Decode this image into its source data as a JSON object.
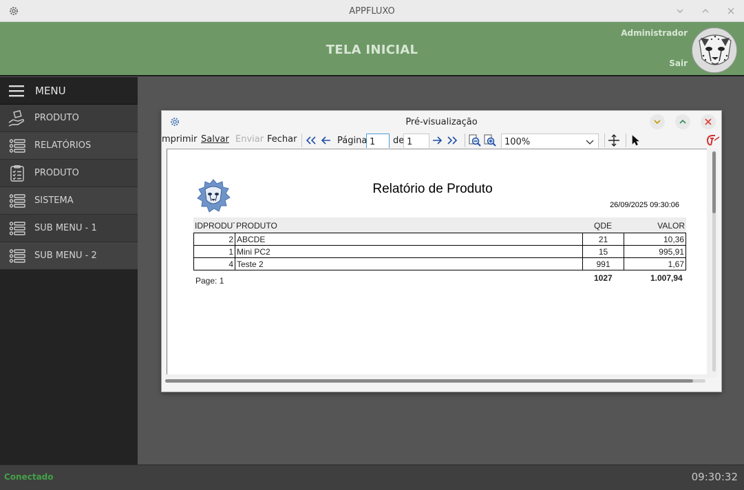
{
  "window": {
    "title": "APPFLUXO"
  },
  "header": {
    "screen_title": "TELA INICIAL",
    "user": "Administrador",
    "logout": "Sair"
  },
  "sidebar": {
    "title": "MENU",
    "items": [
      {
        "label": "PRODUTO",
        "icon": "hand-box-icon"
      },
      {
        "label": "RELATÓRIOS",
        "icon": "list-icon"
      },
      {
        "label": "PRODUTO",
        "icon": "checklist-icon"
      },
      {
        "label": "SISTEMA",
        "icon": "list-icon"
      },
      {
        "label": "SUB MENU - 1",
        "icon": "list-icon"
      },
      {
        "label": "SUB MENU - 2",
        "icon": "list-icon"
      }
    ]
  },
  "status": {
    "connection": "Conectado",
    "time": "09:30:32",
    "connection_color": "#43a047"
  },
  "preview": {
    "title": "Pré-visualização",
    "toolbar": {
      "print": "mprimir",
      "save": "Salvar",
      "send": "Enviar",
      "close": "Fechar",
      "page_label": "Página",
      "page_value": "1",
      "of_label": "de",
      "of_value": "1",
      "zoom": "100%"
    },
    "report": {
      "title": "Relatório de Produto",
      "datetime": "26/09/2025 09:30:06",
      "columns": [
        "IDPRODUTO",
        "PRODUTO",
        "QDE",
        "VALOR"
      ],
      "rows": [
        {
          "id": "2",
          "produto": "ABCDE",
          "qde": "21",
          "valor": "10,36"
        },
        {
          "id": "1",
          "produto": "Mini PC2",
          "qde": "15",
          "valor": "995,91"
        },
        {
          "id": "4",
          "produto": "Teste 2",
          "qde": "991",
          "valor": "1,67"
        }
      ],
      "page_footer": "Page: 1",
      "total_qde": "1027",
      "total_valor": "1.007,94"
    }
  },
  "colors": {
    "header_bg": "#6e9967",
    "sidebar_bg": "#232323",
    "close_btn": "#e53935",
    "accent": "#4a9fd8"
  }
}
